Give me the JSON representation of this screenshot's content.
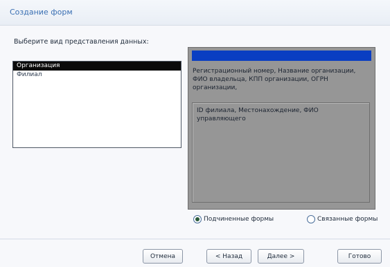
{
  "dialog": {
    "title": "Создание форм"
  },
  "prompt": "Выберите вид представления данных:",
  "list": {
    "items": [
      {
        "label": "Организация",
        "selected": true
      },
      {
        "label": "Филиал",
        "selected": false
      }
    ]
  },
  "preview": {
    "main_fields": "Регистрационный номер, Название организации, ФИО владельца, КПП организации, ОГРН организации,",
    "sub_fields": "ID филиала, Местонахождение, ФИО управляющего"
  },
  "options": {
    "subforms_label": "Подчиненные формы",
    "linked_label": "Связанные формы",
    "selected": "subforms"
  },
  "buttons": {
    "cancel": "Отмена",
    "back": "< Назад",
    "next": "Далее >",
    "finish": "Готово"
  },
  "colors": {
    "preview_header": "#0a3ec2",
    "preview_bg": "#969696",
    "selected_item": "#0a0a0a"
  }
}
